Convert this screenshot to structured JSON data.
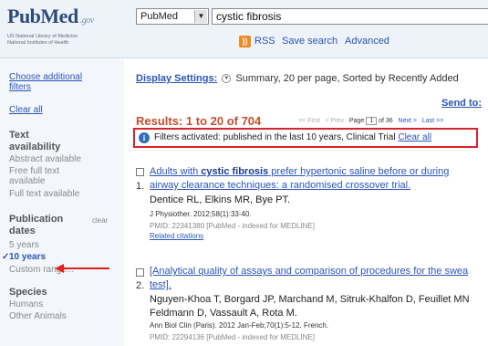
{
  "header": {
    "logo_text": "PubMed",
    "logo_gov": ".gov",
    "logo_sub_1": "US National Library of Medicine",
    "logo_sub_2": "National Institutes of Health",
    "database": "PubMed",
    "search_value": "cystic fibrosis",
    "rss_label": "RSS",
    "save_search_label": "Save search",
    "advanced_label": "Advanced"
  },
  "sidebar": {
    "choose_filters": [
      "Choose additional",
      "filters"
    ],
    "clear_all": "Clear all",
    "text_availability": [
      "Text",
      "availability"
    ],
    "abstract_available": "Abstract available",
    "free_full_text": [
      "Free full text",
      "available"
    ],
    "full_text_available": "Full text available",
    "publication_dates": [
      "Publication",
      "dates"
    ],
    "clear_label": "clear",
    "five_years": "5 years",
    "ten_years": "10 years",
    "checkmark": "✓",
    "custom_range": "Custom range...",
    "species": "Species",
    "humans": "Humans",
    "other_animals": "Other Animals"
  },
  "main": {
    "display_settings_label": "Display Settings:",
    "display_settings_value": "Summary, 20 per page, Sorted by Recently Added",
    "send_to": "Send to:",
    "results_text": "Results: 1 to 20 of 704",
    "pager": {
      "first": "<< First",
      "prev": "< Prev",
      "page_label": "Page",
      "page_value": "1",
      "of_pages": "of 36",
      "next": "Next >",
      "last": "Last >>"
    },
    "filter_text": "Filters activated: published in the last 10 years, Clinical Trial",
    "filter_clear": "Clear all",
    "results": [
      {
        "number": "1.",
        "title_pre": "Adults with ",
        "title_bold": "cystic fibrosis",
        "title_post": " prefer hypertonic saline before or during",
        "title_line2": "airway clearance techniques: a randomised crossover trial.",
        "authors": "Dentice RL, Elkins MR, Bye PT.",
        "authors_line2": "",
        "journal": "J Physiother. 2012;58(1):33-40.",
        "pmid": "PMID: 22341380 [PubMed - indexed for MEDLINE]",
        "related": "Related citations"
      },
      {
        "number": "2.",
        "title_pre": "[Analytical quality of assays and comparison of procedures for the swea",
        "title_bold": "",
        "title_post": "",
        "title_line2": "test].",
        "authors": "Nguyen-Khoa T, Borgard JP, Marchand M, Sitruk-Khalfon D, Feuillet MN",
        "authors_line2": "Feldmann D, Vassault A, Rota M.",
        "journal": "Ann Biol Clin (Paris). 2012 Jan-Feb;70(1):5-12. French.",
        "pmid": "PMID: 22294136 [PubMed - indexed for MEDLINE]",
        "related": ""
      }
    ]
  }
}
